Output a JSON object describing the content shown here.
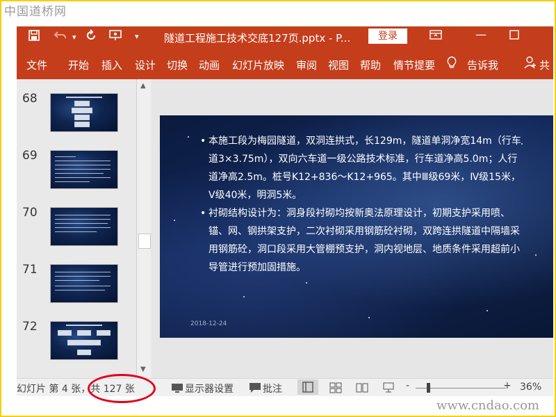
{
  "watermarks": {
    "top": "中国道桥网",
    "bottom": "www.cndao.com"
  },
  "titlebar": {
    "icons": [
      "save-icon",
      "undo-icon",
      "redo-icon",
      "present-icon",
      "customize-icon"
    ],
    "title": "隧道工程施工技术交底127页.pptx  -  P...",
    "login": "登录",
    "controls": [
      "ribbon-display-icon",
      "minimize-icon",
      "maximize-icon"
    ]
  },
  "menubar": {
    "items": [
      "文件",
      "开始",
      "插入",
      "设计",
      "切换",
      "动画",
      "幻灯片放映",
      "审阅",
      "视图",
      "帮助",
      "情节提要"
    ],
    "tell_me": "告诉我",
    "share": "共"
  },
  "thumbnails": [
    {
      "number": "68"
    },
    {
      "number": "69"
    },
    {
      "number": "70"
    },
    {
      "number": "71"
    },
    {
      "number": "72"
    }
  ],
  "slide": {
    "bullets": [
      "本施工段为梅园隧道，双洞连拱式，长129m，隧道单洞净宽14m（行车道3×3.75m），双向六车道一级公路技术标准，行车道净高5.0m；人行道净高2.5m。桩号K12+836～K12+965。其中Ⅲ级69米，Ⅳ级15米，Ⅴ级40米，明洞5米。",
      "衬砌结构设计为：洞身段衬砌均按新奥法原理设计，初期支护采用喷、锚、网、钢拱架支护，二次衬砌采用钢筋砼衬砌，双跨连拱隧道中隔墙采用钢筋砼，洞口段采用大管棚预支护，洞内视地层、地质条件采用超前小导管进行预加固措施。"
    ],
    "date": "2018-12-24"
  },
  "statusbar": {
    "slide_info": "幻灯片 第 4 张，共 127 张",
    "display_settings": "显示器设置",
    "comments": "批注",
    "zoom_minus": "-",
    "zoom_plus": "+",
    "zoom": "36%"
  },
  "colors": {
    "accent": "#c43e1c",
    "highlight_circle": "#e2001a"
  }
}
